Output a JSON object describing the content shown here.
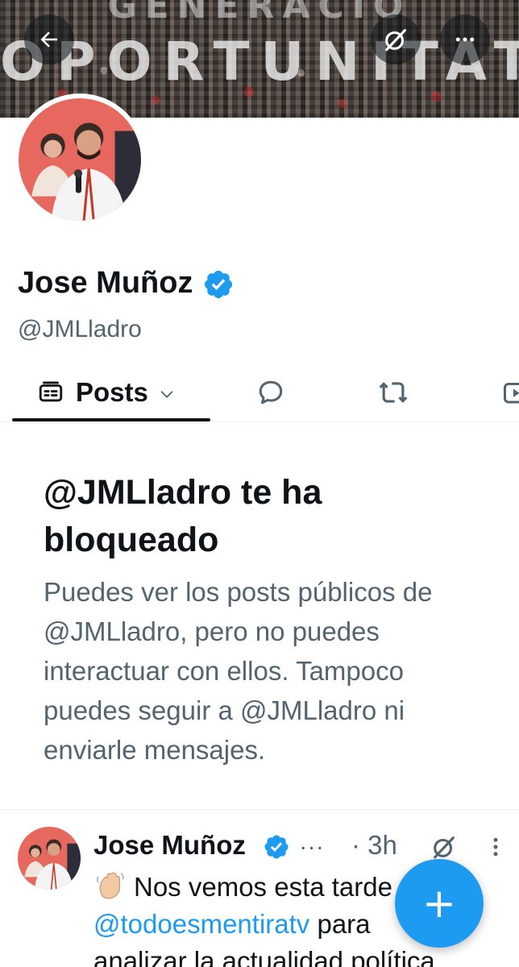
{
  "banner": {
    "line1": "GENERACIÓ",
    "line2": "OPORTUNITATS"
  },
  "profile": {
    "display_name": "Jose Muñoz",
    "handle": "@JMLladro",
    "verified": true
  },
  "tabs": [
    {
      "label": "Posts",
      "icon": "posts-icon",
      "selected": true,
      "has_dropdown": true
    },
    {
      "label": "",
      "icon": "reply-icon"
    },
    {
      "label": "",
      "icon": "repost-icon"
    },
    {
      "label": "",
      "icon": "media-icon"
    }
  ],
  "blocked": {
    "title": "@JMLladro te ha bloqueado",
    "description": "Puedes ver los posts públicos de @JMLladro, pero no puedes interactuar con ellos. Tampoco puedes seguir a @JMLladro ni enviarle mensajes."
  },
  "post": {
    "author": "Jose Muñoz",
    "ellipsis": "...",
    "time": "· 3h",
    "line1_text": "Nos vemos esta tarde",
    "mention": "@todoesmentiratv",
    "line2_text": " para",
    "line3_text": "analizar la actualidad política"
  },
  "fab": {
    "label": "+"
  },
  "colors": {
    "accent": "#1d9bf0",
    "text_primary": "#0f1419",
    "text_secondary": "#536471"
  }
}
